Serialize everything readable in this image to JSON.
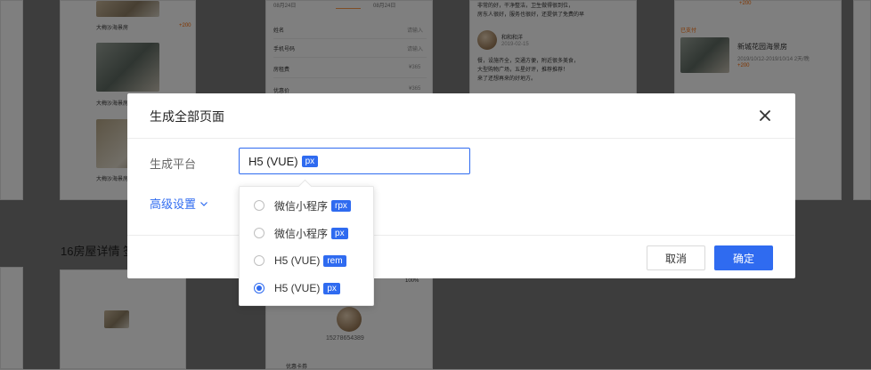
{
  "background": {
    "listing_title": "大梅沙海景房",
    "listing_price": "+200",
    "form_rows": [
      {
        "label": "姓名",
        "value": "请输入"
      },
      {
        "label": "手机号码",
        "value": "请输入"
      },
      {
        "label": "房租费",
        "value": "¥365"
      },
      {
        "label": "优惠价",
        "value": "¥365"
      }
    ],
    "date_a": "08月24日",
    "date_b": "08月24日",
    "review_user": "和和和洋",
    "review_date": "2019-02-15",
    "review_text_1": "非常的好，干净整洁，卫生做得很到位，",
    "review_text_2": "房东人很好，服务也很好，还提供了免费的早",
    "review_text_3": "餐，设施齐全，交通方便，附近很多美食，",
    "review_text_4": "大型购物广场，五星好评，推荐推荐！",
    "review_text_5": "来了还想再来的好地方。",
    "status_paid": "已支付",
    "house_name": "新城花园海景房",
    "house_dates": "2019/10/12-2019/10/14 2天/晚",
    "paid_price": "+200",
    "section_title": "16房屋详情 签",
    "phone_number": "15278654389",
    "badge_100": "100%",
    "coupon_label": "优惠卡券"
  },
  "modal": {
    "title": "生成全部页面",
    "platform_label": "生成平台",
    "selected_value": "H5 (VUE)",
    "selected_unit": "px",
    "advanced_label": "高级设置",
    "cancel_label": "取消",
    "confirm_label": "确定"
  },
  "dropdown": {
    "options": [
      {
        "label": "微信小程序",
        "unit": "rpx",
        "checked": false
      },
      {
        "label": "微信小程序",
        "unit": "px",
        "checked": false
      },
      {
        "label": "H5 (VUE)",
        "unit": "rem",
        "checked": false
      },
      {
        "label": "H5 (VUE)",
        "unit": "px",
        "checked": true
      }
    ]
  },
  "colors": {
    "accent": "#2f6bf0",
    "overlay": "rgba(0,0,0,0.5)",
    "price": "#ff6a00"
  }
}
